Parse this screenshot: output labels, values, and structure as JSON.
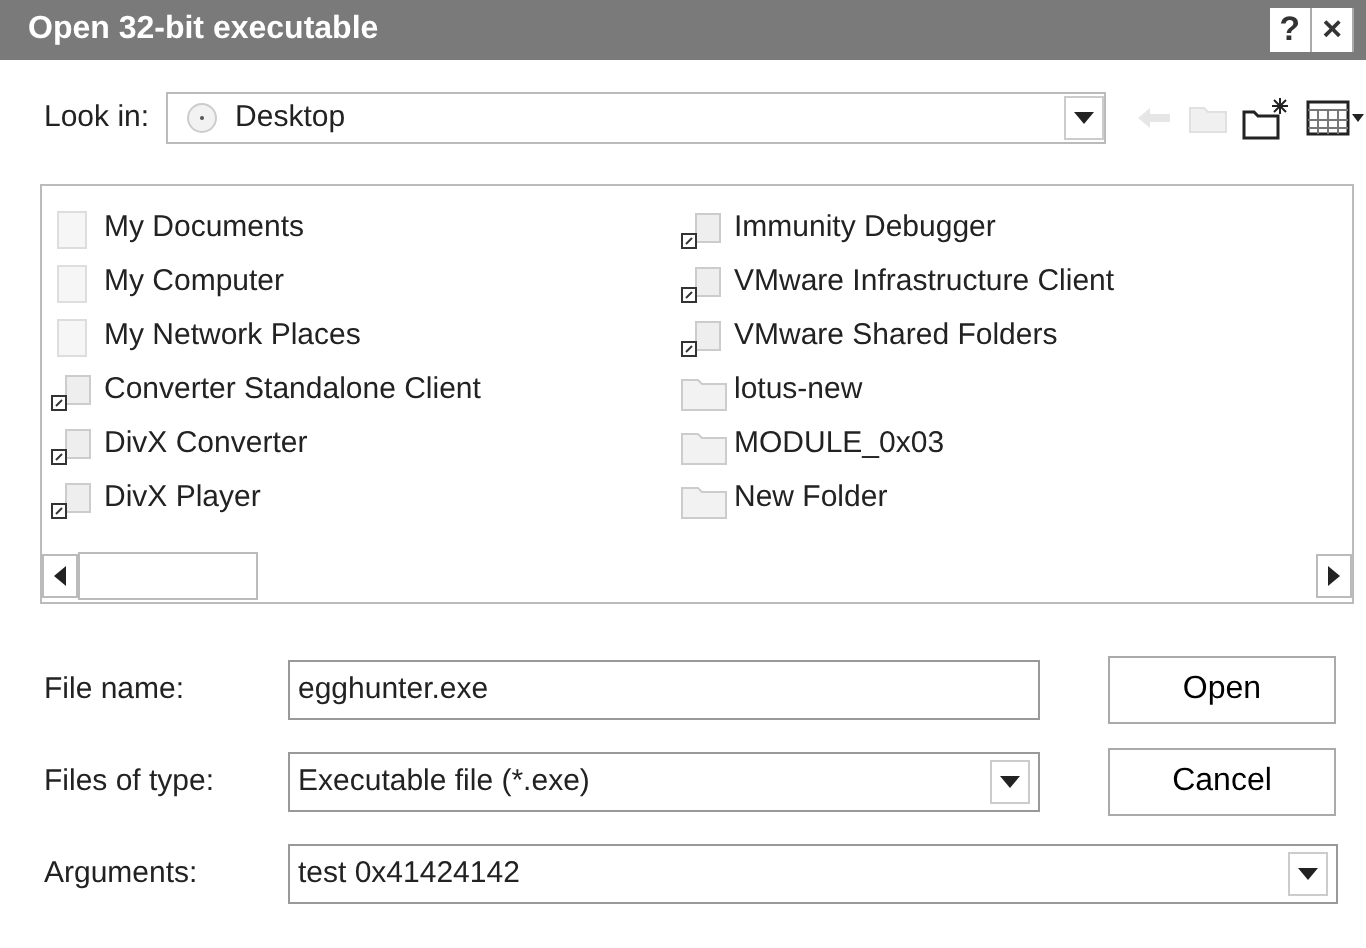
{
  "window": {
    "title": "Open 32-bit executable",
    "help": "?",
    "close": "×"
  },
  "look_in": {
    "label": "Look in:",
    "value": "Desktop"
  },
  "files": [
    {
      "name": "My Documents",
      "kind": "system"
    },
    {
      "name": "My Computer",
      "kind": "system"
    },
    {
      "name": "My Network Places",
      "kind": "system"
    },
    {
      "name": "Converter Standalone Client",
      "kind": "shortcut"
    },
    {
      "name": "DivX Converter",
      "kind": "shortcut"
    },
    {
      "name": "DivX Player",
      "kind": "shortcut"
    },
    {
      "name": "Immunity Debugger",
      "kind": "shortcut"
    },
    {
      "name": "VMware Infrastructure Client",
      "kind": "shortcut"
    },
    {
      "name": "VMware Shared Folders",
      "kind": "shortcut"
    },
    {
      "name": "lotus-new",
      "kind": "folder"
    },
    {
      "name": "MODULE_0x03",
      "kind": "folder"
    },
    {
      "name": "New Folder",
      "kind": "folder"
    }
  ],
  "file_name": {
    "label": "File name:",
    "value": "egghunter.exe"
  },
  "file_type": {
    "label": "Files of type:",
    "value": "Executable file (*.exe)"
  },
  "arguments": {
    "label": "Arguments:",
    "value": "test 0x41424142"
  },
  "buttons": [
    "Open",
    "Cancel"
  ]
}
